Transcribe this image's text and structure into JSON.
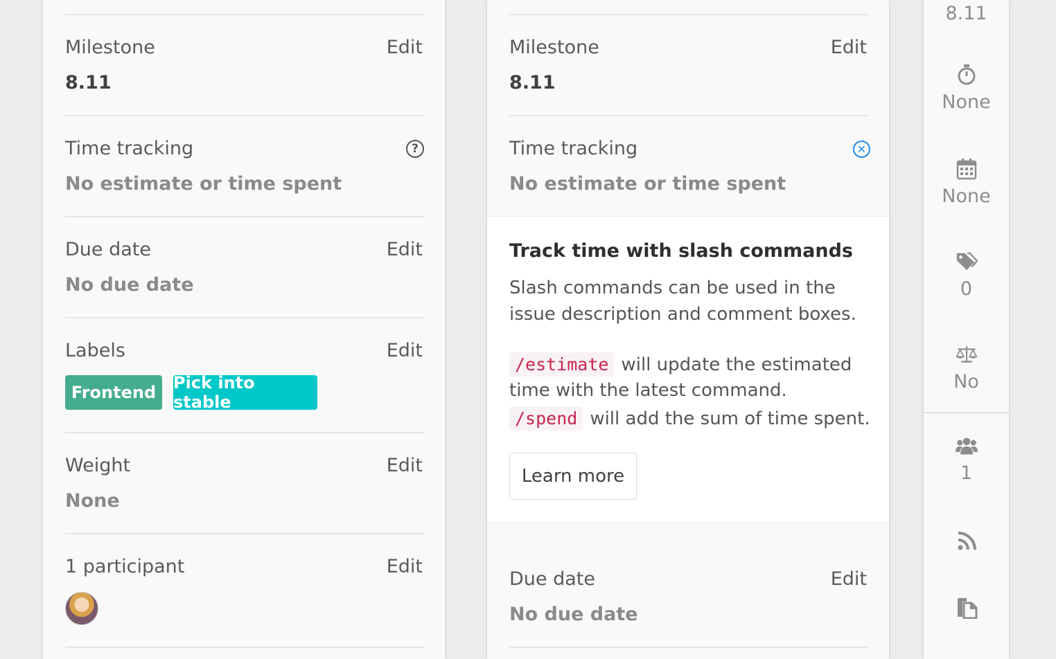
{
  "panel_a": {
    "milestone": {
      "label": "Milestone",
      "edit": "Edit",
      "value": "8.11"
    },
    "time_tracking": {
      "label": "Time tracking",
      "help_icon": "question-circle",
      "value": "No estimate or time spent"
    },
    "due_date": {
      "label": "Due date",
      "edit": "Edit",
      "value": "No due date"
    },
    "labels": {
      "label": "Labels",
      "edit": "Edit",
      "tags": [
        "Frontend",
        "Pick into stable"
      ],
      "tag_colors": [
        "#44ad8e",
        "#00c8c8"
      ]
    },
    "weight": {
      "label": "Weight",
      "edit": "Edit",
      "value": "None"
    },
    "participants": {
      "label": "1 participant",
      "edit": "Edit"
    }
  },
  "panel_b": {
    "milestone": {
      "label": "Milestone",
      "edit": "Edit",
      "value": "8.11"
    },
    "time_tracking": {
      "label": "Time tracking",
      "close_icon": "close-circle",
      "value": "No estimate or time spent"
    },
    "help_popover": {
      "title": "Track time with slash commands",
      "description": "Slash commands can be used in the issue description and comment boxes.",
      "estimate_code": "/estimate",
      "estimate_text_1": "will update the estimated",
      "estimate_text_2": "time with the latest command.",
      "spend_code": "/spend",
      "spend_text": "will add the sum of time spent.",
      "learn_more": "Learn more"
    },
    "due_date": {
      "label": "Due date",
      "edit": "Edit",
      "value": "No due date"
    }
  },
  "collapsed_sidebar": {
    "milestone": "8.11",
    "time_tracking": "None",
    "due_date": "None",
    "labels_count": "0",
    "weight": "No",
    "participants_count": "1"
  },
  "colors": {
    "accent_blue": "#1f8ceb",
    "code_red": "#c7254e"
  }
}
